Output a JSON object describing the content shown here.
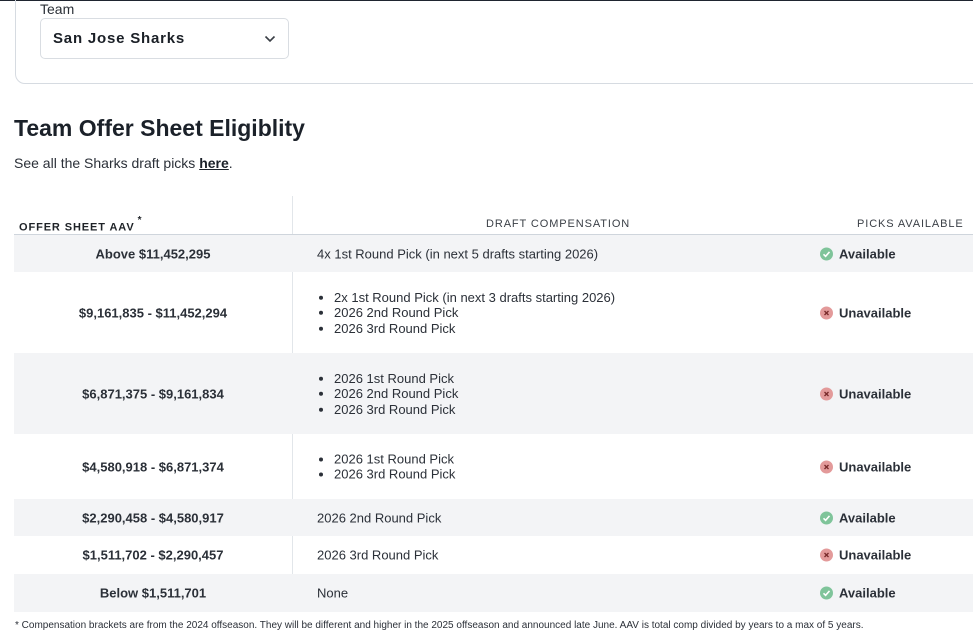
{
  "team": {
    "label": "Team",
    "selected": "San Jose Sharks"
  },
  "section": {
    "title": "Team Offer Sheet Eligiblity",
    "desc_prefix": "See all the Sharks draft picks ",
    "desc_link": "here",
    "desc_suffix": "."
  },
  "table": {
    "headers": {
      "aav": "OFFER SHEET AAV",
      "aav_mark": "*",
      "compensation": "DRAFT COMPENSATION",
      "picks": "PICKS AVAILABLE"
    },
    "rows": [
      {
        "aav": "Above $11,452,295",
        "compensation": [
          "4x 1st Round Pick (in next 5 drafts starting 2026)"
        ],
        "status": "Available"
      },
      {
        "aav": "$9,161,835 - $11,452,294",
        "compensation": [
          "2x 1st Round Pick (in next 3 drafts starting 2026)",
          "2026 2nd Round Pick",
          "2026 3rd Round Pick"
        ],
        "status": "Unavailable"
      },
      {
        "aav": "$6,871,375 - $9,161,834",
        "compensation": [
          "2026 1st Round Pick",
          "2026 2nd Round Pick",
          "2026 3rd Round Pick"
        ],
        "status": "Unavailable"
      },
      {
        "aav": "$4,580,918 - $6,871,374",
        "compensation": [
          "2026 1st Round Pick",
          "2026 3rd Round Pick"
        ],
        "status": "Unavailable"
      },
      {
        "aav": "$2,290,458 - $4,580,917",
        "compensation": [
          "2026 2nd Round Pick"
        ],
        "status": "Available"
      },
      {
        "aav": "$1,511,702 - $2,290,457",
        "compensation": [
          "2026 3rd Round Pick"
        ],
        "status": "Unavailable"
      },
      {
        "aav": "Below $1,511,701",
        "compensation": [
          "None"
        ],
        "status": "Available"
      }
    ]
  },
  "footnote": "* Compensation brackets are from the 2024 offseason. They will be different and higher in the 2025 offseason and announced late June. AAV is total comp divided by years to a max of 5 years.",
  "colors": {
    "available": "#7fc49a",
    "unavailable": "#e39a9a",
    "row_shade": "#f3f4f6"
  },
  "icons": {
    "available": "check-icon",
    "unavailable": "x-icon",
    "select": "chevron-down-icon"
  }
}
